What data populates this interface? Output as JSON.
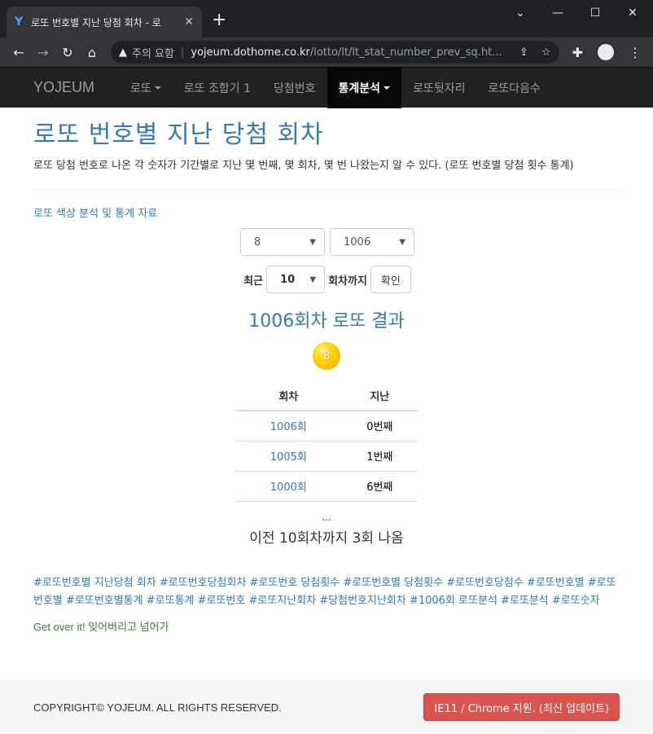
{
  "browser": {
    "tab_title": "로또 번호별 지난 당첨 회차 - 로",
    "security_label": "주의 요함",
    "url_host": "yojeum.dothome.co.kr",
    "url_path": "/lotto/lt/lt_stat_number_prev_sq.ht..."
  },
  "navbar": {
    "brand": "YOJEUM",
    "items": [
      {
        "label": "로또",
        "caret": true,
        "active": false
      },
      {
        "label": "로또 조합기 1",
        "caret": false,
        "active": false
      },
      {
        "label": "당첨번호",
        "caret": false,
        "active": false
      },
      {
        "label": "통계분석",
        "caret": true,
        "active": true
      },
      {
        "label": "로또뒷자리",
        "caret": false,
        "active": false
      },
      {
        "label": "로또다음수",
        "caret": false,
        "active": false
      }
    ]
  },
  "page": {
    "title": "로또 번호별 지난 당첨 회차",
    "description": "로또 당첨 번호로 나온 각 숫자가 기간별로 지난 몇 번째, 몇 회차, 몇 번 나왔는지 알 수 있다. (로또 번호별 당첨 횟수 통계)",
    "color_link": "로또 색상 분석 및 통계 자료"
  },
  "form": {
    "number_select": "8",
    "round_select": "1006",
    "recent_label": "최근",
    "recent_select": "10",
    "until_label": "회차까지",
    "confirm_button": "확인"
  },
  "result": {
    "title": "1006회차 로또 결과",
    "ball_number": "8",
    "ball_color": "#ffd400",
    "table_headers": [
      "회차",
      "지난"
    ],
    "rows": [
      {
        "round": "1006회",
        "ago": "0번째"
      },
      {
        "round": "1005회",
        "ago": "1번째"
      },
      {
        "round": "1000회",
        "ago": "6번째"
      }
    ],
    "ellipsis": "...",
    "summary": "이전 10회차까지 3회 나옴"
  },
  "tags": "#로또번호별 지난당첨 회차 #로또번호당첨회차 #로또번호 당첨횟수 #로또번호별 당첨횟수 #로또번호당첨수 #로또번호별 #로또번호별 #로또번호별통계 #로또통계 #로또번호 #로또지난회차 #당첨번호지난회차 #1006회 로또분석 #로또분석 #로또숫자",
  "motto": "Get over it! 잊어버리고 넘어가",
  "footer": {
    "copyright": "COPYRIGHT© YOJEUM. ALL RIGHTS RESERVED.",
    "support_button": "IE11 / Chrome 지원. (최신 업데이트)"
  }
}
